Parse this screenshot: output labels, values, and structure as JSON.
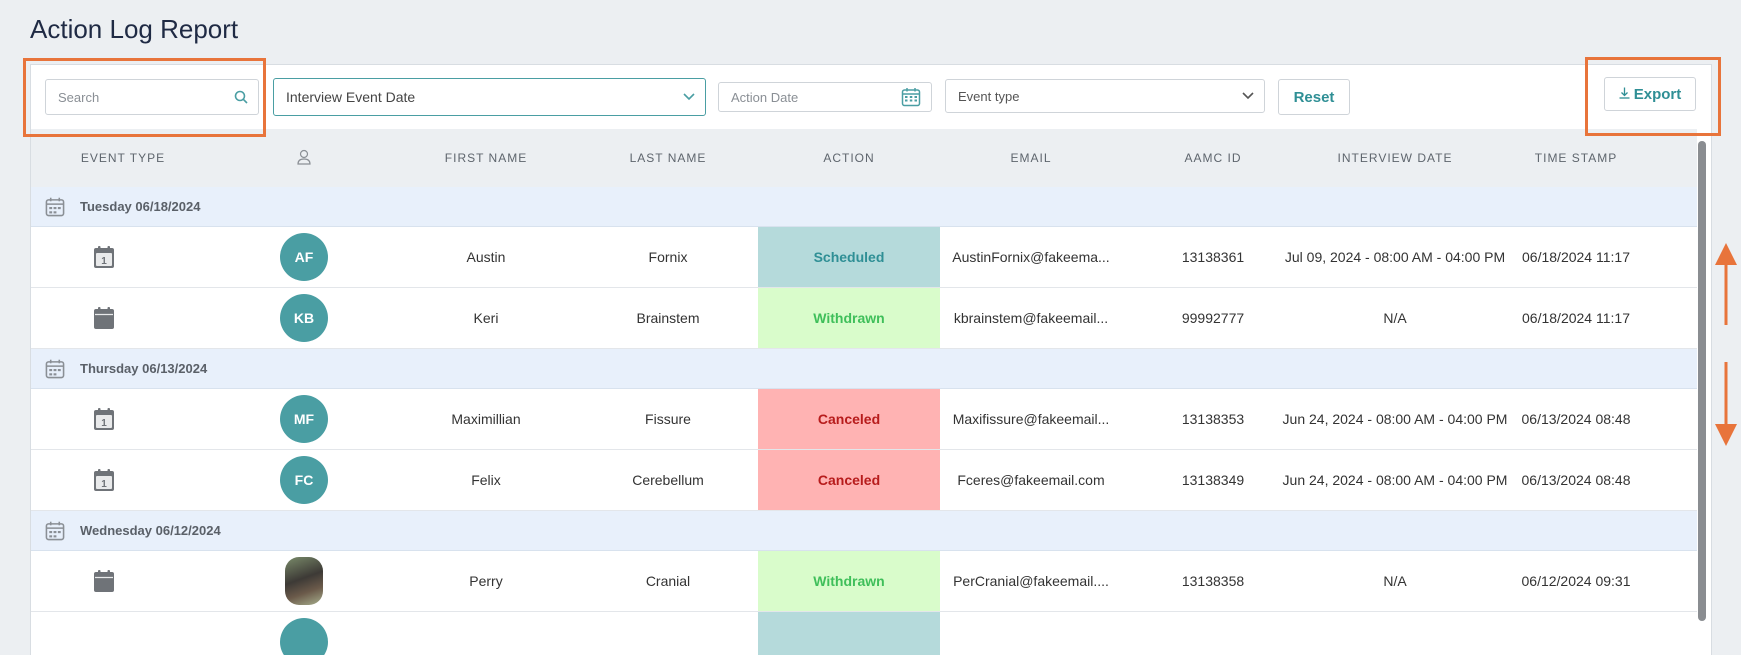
{
  "page": {
    "title": "Action Log Report"
  },
  "filters": {
    "search_placeholder": "Search",
    "date_type_selected": "Interview Event Date",
    "action_date_placeholder": "Action Date",
    "event_type_placeholder": "Event type",
    "reset_label": "Reset",
    "export_label": "Export"
  },
  "table": {
    "headers": {
      "event_type": "EVENT TYPE",
      "first_name": "FIRST NAME",
      "last_name": "LAST NAME",
      "action": "ACTION",
      "email": "EMAIL",
      "aamc_id": "AAMC ID",
      "interview_date": "INTERVIEW DATE",
      "time_stamp": "TIME STAMP"
    },
    "groups": [
      {
        "label": "Tuesday 06/18/2024",
        "rows": [
          {
            "icon": "calendar-day-icon",
            "initials": "AF",
            "first": "Austin",
            "last": "Fornix",
            "action": "Scheduled",
            "email": "AustinFornix@fakeema...",
            "aamc": "13138361",
            "interview": "Jul 09, 2024 - 08:00 AM - 04:00 PM",
            "stamp": "06/18/2024 11:17"
          },
          {
            "icon": "calendar-icon",
            "initials": "KB",
            "first": "Keri",
            "last": "Brainstem",
            "action": "Withdrawn",
            "email": "kbrainstem@fakeemail...",
            "aamc": "99992777",
            "interview": "N/A",
            "stamp": "06/18/2024 11:17"
          }
        ]
      },
      {
        "label": "Thursday 06/13/2024",
        "rows": [
          {
            "icon": "calendar-day-icon",
            "initials": "MF",
            "first": "Maximillian",
            "last": "Fissure",
            "action": "Canceled",
            "email": "Maxifissure@fakeemail...",
            "aamc": "13138353",
            "interview": "Jun 24, 2024 - 08:00 AM - 04:00 PM",
            "stamp": "06/13/2024 08:48"
          },
          {
            "icon": "calendar-day-icon",
            "initials": "FC",
            "first": "Felix",
            "last": "Cerebellum",
            "action": "Canceled",
            "email": "Fceres@fakeemail.com",
            "aamc": "13138349",
            "interview": "Jun 24, 2024 - 08:00 AM - 04:00 PM",
            "stamp": "06/13/2024 08:48"
          }
        ]
      },
      {
        "label": "Wednesday 06/12/2024",
        "rows": [
          {
            "icon": "calendar-icon",
            "initials": "",
            "first": "Perry",
            "last": "Cranial",
            "action": "Withdrawn",
            "email": "PerCranial@fakeemail....",
            "aamc": "13138358",
            "interview": "N/A",
            "stamp": "06/12/2024 09:31"
          }
        ]
      }
    ]
  },
  "colors": {
    "accent": "#4a9ea3",
    "scheduled_bg": "#b5dadb",
    "scheduled_fg": "#2f8f95",
    "withdrawn_bg": "#d9fccb",
    "withdrawn_fg": "#3fbf5a",
    "canceled_bg": "#ffb3b3",
    "canceled_fg": "#b71c1c",
    "highlight": "#e8743b"
  }
}
